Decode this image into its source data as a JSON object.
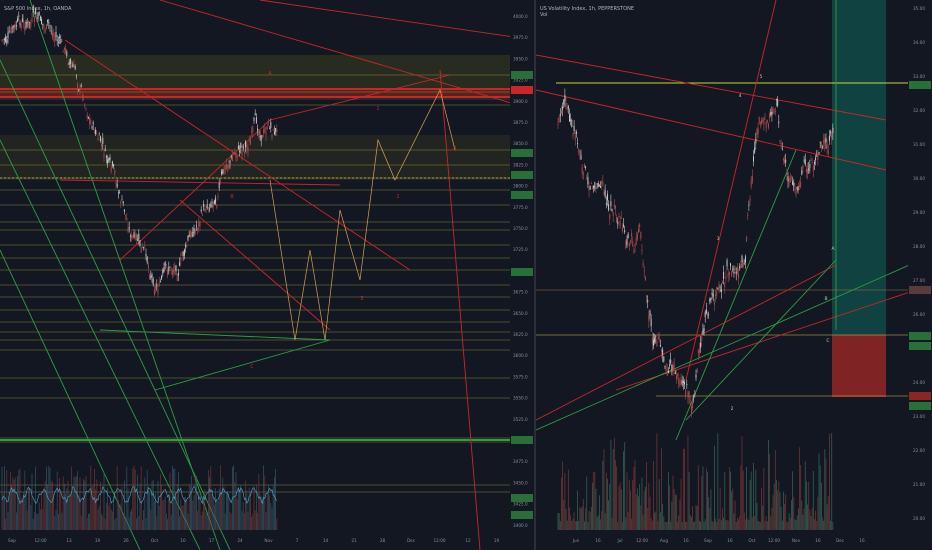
{
  "colors": {
    "background": "#131722",
    "candle_up": "#c9c9c9",
    "candle_down": "#a84a4a",
    "trend_red": "#c62828",
    "trend_green": "#2e9e45",
    "yellow_line": "#d4c84a",
    "price_tag_green": "#4caf50",
    "zone_olive": "#3b3d1f",
    "zone_red": "#6b1f1f",
    "target_teal": "#0f4a46",
    "stop_red": "#8c2525"
  },
  "left_chart": {
    "title": "S&P 500 Index, 1h, OANDA",
    "price_labels": [
      "4000.0",
      "3975.0",
      "3950.0",
      "3925.0",
      "3900.0",
      "3875.0",
      "3850.0",
      "3825.0",
      "3800.0",
      "3775.0",
      "3750.0",
      "3725.0",
      "3700.0",
      "3675.0",
      "3650.0",
      "3625.0",
      "3600.0",
      "3575.0",
      "3550.0",
      "3525.0",
      "3500.0",
      "3475.0",
      "3450.0",
      "3425.0",
      "3400.0"
    ],
    "date_labels": [
      "Sep",
      "12:00",
      "13",
      "19",
      "26",
      "Oct",
      "10",
      "17",
      "24",
      "Nov",
      "7",
      "14",
      "21",
      "28",
      "Dec",
      "12:00",
      "12",
      "19"
    ],
    "wave_labels": [
      "1",
      "2",
      "3",
      "4",
      "5",
      "A",
      "B",
      "C"
    ]
  },
  "right_chart": {
    "title": "US Volatility Index, 1h, PEPPERSTONE",
    "subtitle": "Vol",
    "price_labels": [
      "35.00",
      "34.00",
      "33.00",
      "32.00",
      "31.00",
      "30.00",
      "29.00",
      "28.00",
      "27.00",
      "26.00",
      "25.00",
      "24.00",
      "23.00",
      "22.00",
      "21.00",
      "20.00"
    ],
    "date_labels": [
      "Jun",
      "16",
      "Jul",
      "12:00",
      "Aug",
      "16",
      "Sep",
      "16",
      "Oct",
      "12:00",
      "Nov",
      "16",
      "Dec",
      "16"
    ],
    "wave_labels": [
      "1",
      "2",
      "3",
      "4",
      "5",
      "A",
      "B",
      "C"
    ]
  }
}
